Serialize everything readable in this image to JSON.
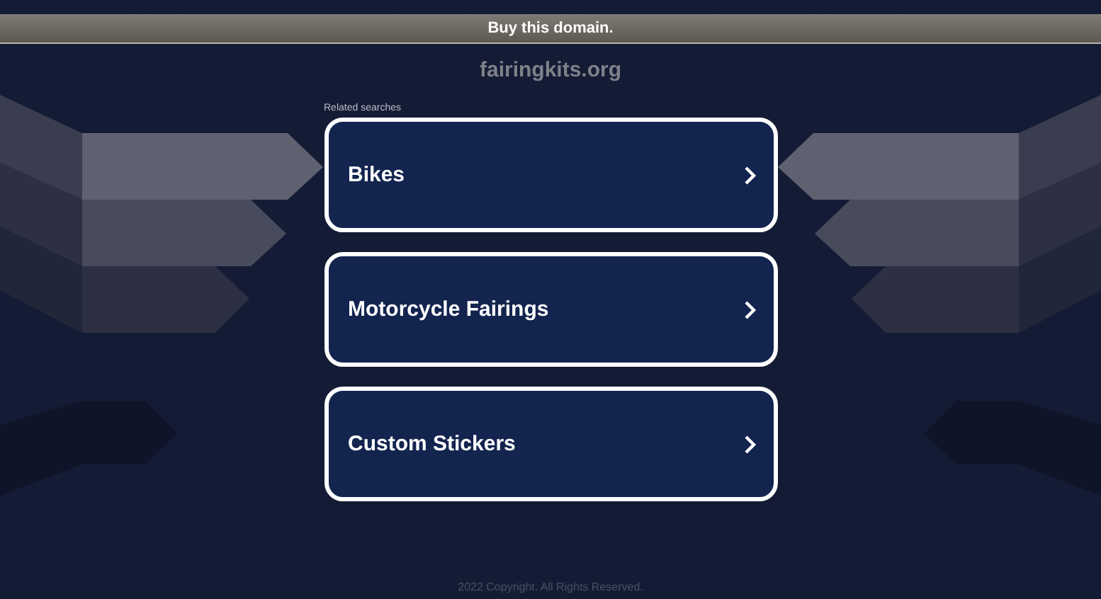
{
  "banner": {
    "text": "Buy this domain."
  },
  "domain": "fairingkits.org",
  "related": {
    "heading": "Related searches",
    "items": [
      {
        "label": "Bikes"
      },
      {
        "label": "Motorcycle Fairings"
      },
      {
        "label": "Custom Stickers"
      }
    ]
  },
  "footer": "2022 Copyright. All Rights Reserved."
}
